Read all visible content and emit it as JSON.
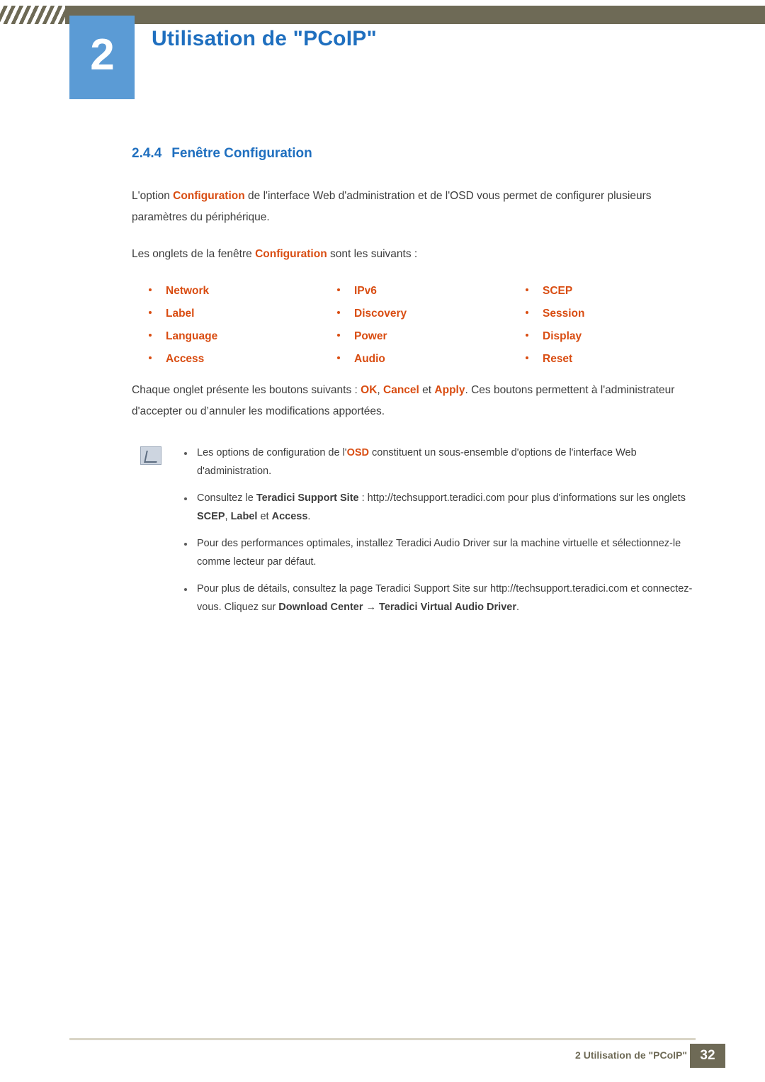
{
  "header": {
    "chapter_number": "2",
    "chapter_title": "Utilisation de \"PCoIP\""
  },
  "section": {
    "number": "2.4.4",
    "title": "Fenêtre Configuration"
  },
  "paragraphs": {
    "intro_1_a": "L'option ",
    "intro_1_kw": "Configuration",
    "intro_1_b": " de l'interface Web d'administration et de l'OSD vous permet de configurer plusieurs paramètres du périphérique.",
    "intro_2_a": "Les onglets de la fenêtre ",
    "intro_2_kw": "Configuration",
    "intro_2_b": " sont les suivants :",
    "buttons_a": "Chaque onglet présente les boutons suivants : ",
    "buttons_ok": "OK",
    "buttons_sep1": ", ",
    "buttons_cancel": "Cancel",
    "buttons_sep2": " et ",
    "buttons_apply": "Apply",
    "buttons_b": ". Ces boutons permettent à l'administrateur d'accepter ou d’annuler les modifications apportées."
  },
  "tabs": [
    [
      "Network",
      "IPv6",
      "SCEP"
    ],
    [
      "Label",
      "Discovery",
      "Session"
    ],
    [
      "Language",
      "Power",
      "Display"
    ],
    [
      "Access",
      "Audio",
      "Reset"
    ]
  ],
  "notes": [
    {
      "t1": "Les options de configuration de l'",
      "kw": "OSD",
      "t2": " constituent un sous-ensemble d'options de l'interface Web d'administration."
    },
    {
      "t1": "Consultez le ",
      "b1": "Teradici Support Site",
      "t2": " : http://techsupport.teradici.com pour plus d'informations sur les onglets ",
      "b2": "SCEP",
      "t3": ", ",
      "b3": "Label",
      "t4": " et ",
      "b4": "Access",
      "t5": "."
    },
    {
      "t1": "Pour des performances optimales, installez Teradici Audio Driver sur la machine virtuelle et sélectionnez-le comme lecteur par défaut."
    },
    {
      "t1": "Pour plus de détails, consultez la page Teradici Support Site sur http://techsupport.teradici.com et connectez-vous. Cliquez sur ",
      "b1": "Download Center",
      "t2": " → ",
      "b2": "Teradici Virtual Audio Driver",
      "t3": "."
    }
  ],
  "footer": {
    "label": "2 Utilisation de \"PCoIP\"",
    "page": "32"
  },
  "colors": {
    "accent_blue": "#1f6fbf",
    "chapter_box": "#5b9bd5",
    "keyword_orange": "#d94d12",
    "footer_olive": "#6e6a56"
  }
}
